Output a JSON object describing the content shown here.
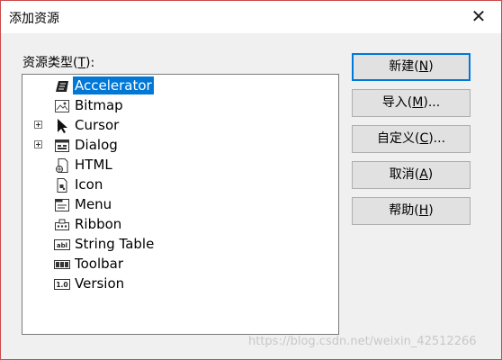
{
  "window": {
    "title": "添加资源",
    "close_glyph": "✕"
  },
  "type_label": {
    "prefix": "资源类型(",
    "accel": "T",
    "suffix": "):"
  },
  "tree_items": [
    {
      "label": "Accelerator",
      "icon": "accelerator-icon",
      "selected": true,
      "expandable": false
    },
    {
      "label": "Bitmap",
      "icon": "bitmap-icon",
      "expandable": false
    },
    {
      "label": "Cursor",
      "icon": "cursor-icon",
      "expandable": true
    },
    {
      "label": "Dialog",
      "icon": "dialog-icon",
      "expandable": true
    },
    {
      "label": "HTML",
      "icon": "html-icon",
      "expandable": false
    },
    {
      "label": "Icon",
      "icon": "icon-resource-icon",
      "expandable": false
    },
    {
      "label": "Menu",
      "icon": "menu-icon",
      "expandable": false
    },
    {
      "label": "Ribbon",
      "icon": "ribbon-icon",
      "expandable": false
    },
    {
      "label": "String Table",
      "icon": "string-table-icon",
      "expandable": false
    },
    {
      "label": "Toolbar",
      "icon": "toolbar-icon",
      "expandable": false
    },
    {
      "label": "Version",
      "icon": "version-icon",
      "expandable": false
    }
  ],
  "buttons": {
    "new": {
      "prefix": "新建(",
      "accel": "N",
      "suffix": ")"
    },
    "import": {
      "prefix": "导入(",
      "accel": "M",
      "suffix": ")..."
    },
    "custom": {
      "prefix": "自定义(",
      "accel": "C",
      "suffix": ")..."
    },
    "cancel": {
      "prefix": "取消(",
      "accel": "A",
      "suffix": ")"
    },
    "help": {
      "prefix": "帮助(",
      "accel": "H",
      "suffix": ")"
    }
  },
  "watermark": "https://blog.csdn.net/weixin_42512266",
  "colors": {
    "selection": "#0078d7",
    "window_border": "#c94a4a",
    "default_button_border": "#0078d7"
  }
}
